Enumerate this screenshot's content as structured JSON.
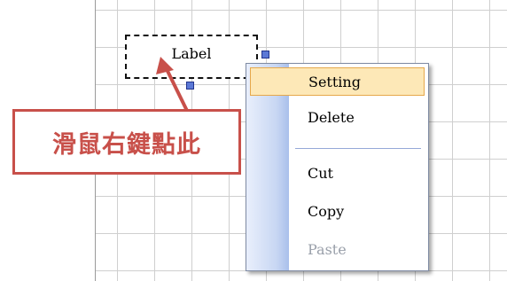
{
  "canvas": {
    "label_control_text": "Label"
  },
  "context_menu": {
    "items": [
      {
        "label": "Setting",
        "state": "highlighted"
      },
      {
        "label": "Delete",
        "state": "normal"
      },
      {
        "label": "Cut",
        "state": "normal"
      },
      {
        "label": "Copy",
        "state": "normal"
      },
      {
        "label": "Paste",
        "state": "disabled"
      }
    ]
  },
  "annotation": {
    "text": "滑鼠右鍵點此",
    "color": "#c8504a"
  },
  "colors": {
    "highlight_fill": "#fde8b7",
    "highlight_border": "#e6a84b",
    "handle": "#5b78d6"
  }
}
